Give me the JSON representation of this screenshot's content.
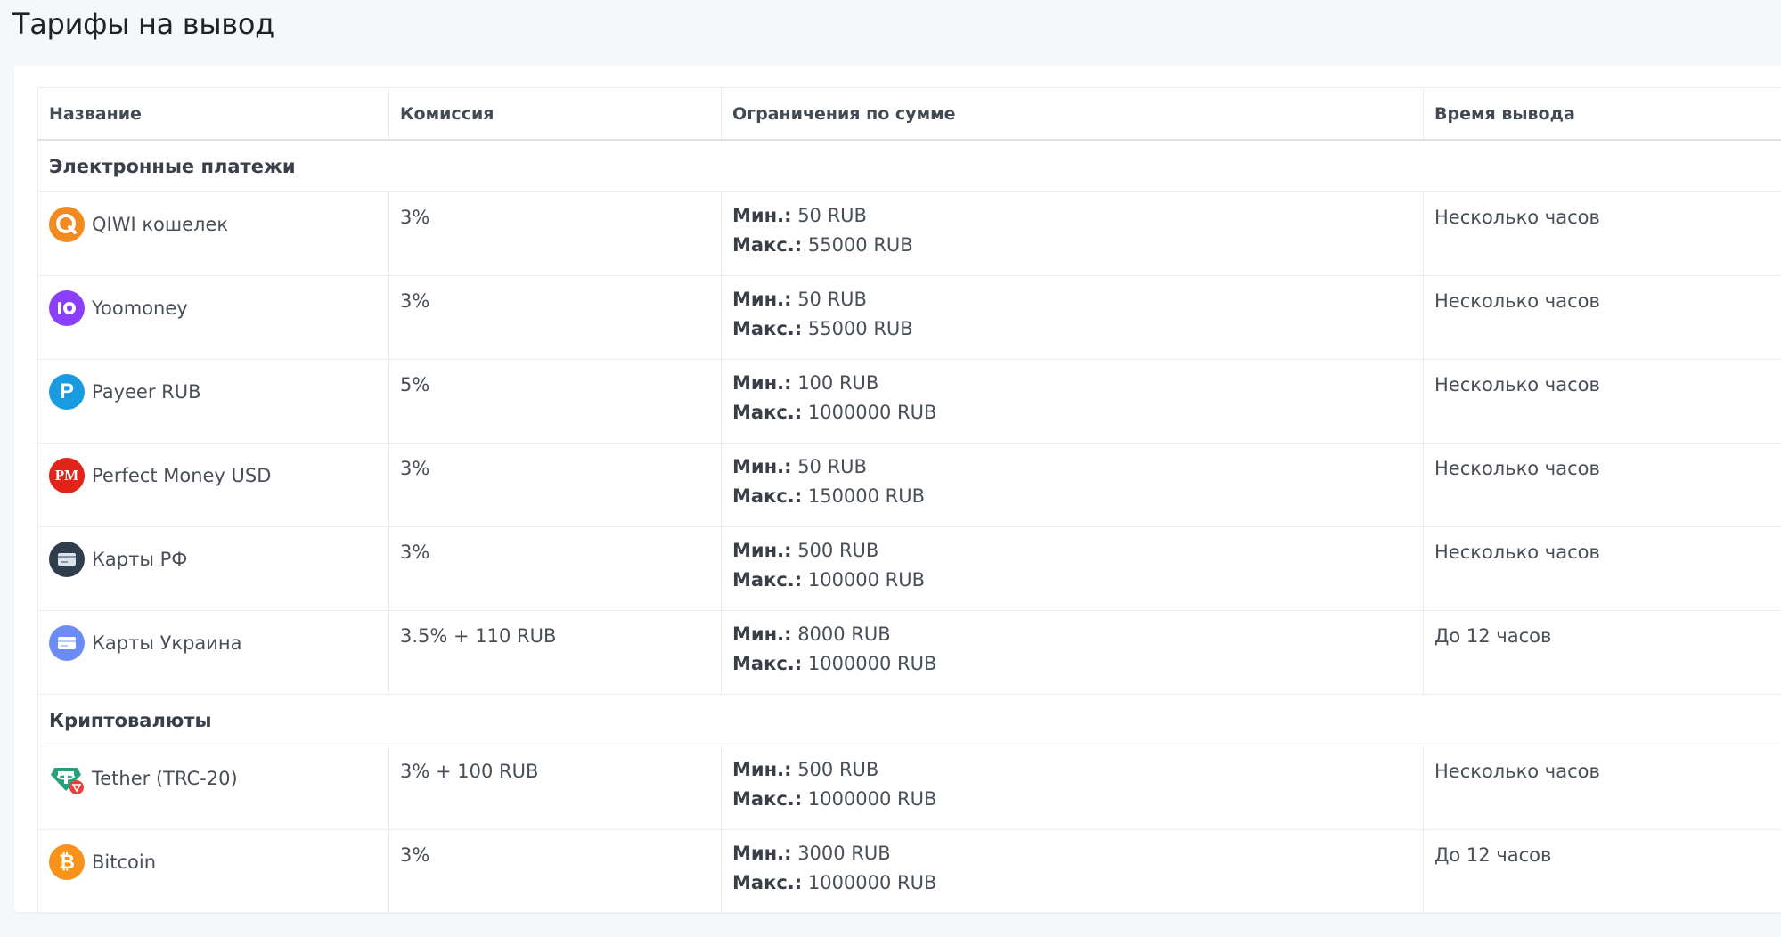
{
  "page": {
    "title": "Тарифы на вывод"
  },
  "table": {
    "headers": [
      "Название",
      "Комиссия",
      "Ограничения по сумме",
      "Время вывода"
    ],
    "min_label": "Мин.:",
    "max_label": "Макс.:",
    "groups": [
      {
        "title": "Электронные платежи",
        "rows": [
          {
            "name": "QIWI кошелек",
            "icon": "qiwi-icon",
            "fee": "3%",
            "min": "50 RUB",
            "max": "55000 RUB",
            "time": "Несколько часов"
          },
          {
            "name": "Yoomoney",
            "icon": "yoomoney-icon",
            "fee": "3%",
            "min": "50 RUB",
            "max": "55000 RUB",
            "time": "Несколько часов"
          },
          {
            "name": "Payeer RUB",
            "icon": "payeer-icon",
            "fee": "5%",
            "min": "100 RUB",
            "max": "1000000 RUB",
            "time": "Несколько часов"
          },
          {
            "name": "Perfect Money USD",
            "icon": "perfect-money-icon",
            "fee": "3%",
            "min": "50 RUB",
            "max": "150000 RUB",
            "time": "Несколько часов"
          },
          {
            "name": "Карты РФ",
            "icon": "card-rf-icon",
            "fee": "3%",
            "min": "500 RUB",
            "max": "100000 RUB",
            "time": "Несколько часов"
          },
          {
            "name": "Карты Украина",
            "icon": "card-ua-icon",
            "fee": "3.5% + 110 RUB",
            "min": "8000 RUB",
            "max": "1000000 RUB",
            "time": "До 12 часов"
          }
        ]
      },
      {
        "title": "Криптовалюты",
        "rows": [
          {
            "name": "Tether (TRC-20)",
            "icon": "tether-icon",
            "fee": "3% + 100 RUB",
            "min": "500 RUB",
            "max": "1000000 RUB",
            "time": "Несколько часов"
          },
          {
            "name": "Bitcoin",
            "icon": "bitcoin-icon",
            "fee": "3%",
            "min": "3000 RUB",
            "max": "1000000 RUB",
            "time": "До 12 часов"
          }
        ]
      }
    ]
  },
  "icon_glyphs": {
    "payeer": "P",
    "perfect_money": "PM",
    "bitcoin": "₿"
  },
  "colors": {
    "qiwi": "#f28b1f",
    "yoomoney": "#8b3ffd",
    "payeer": "#1a9be0",
    "perfect_money": "#e2231a",
    "card_rf": "#2f3d4c",
    "card_ua": "#6b8cf5",
    "tether": "#26a17b",
    "bitcoin": "#f7931a"
  }
}
